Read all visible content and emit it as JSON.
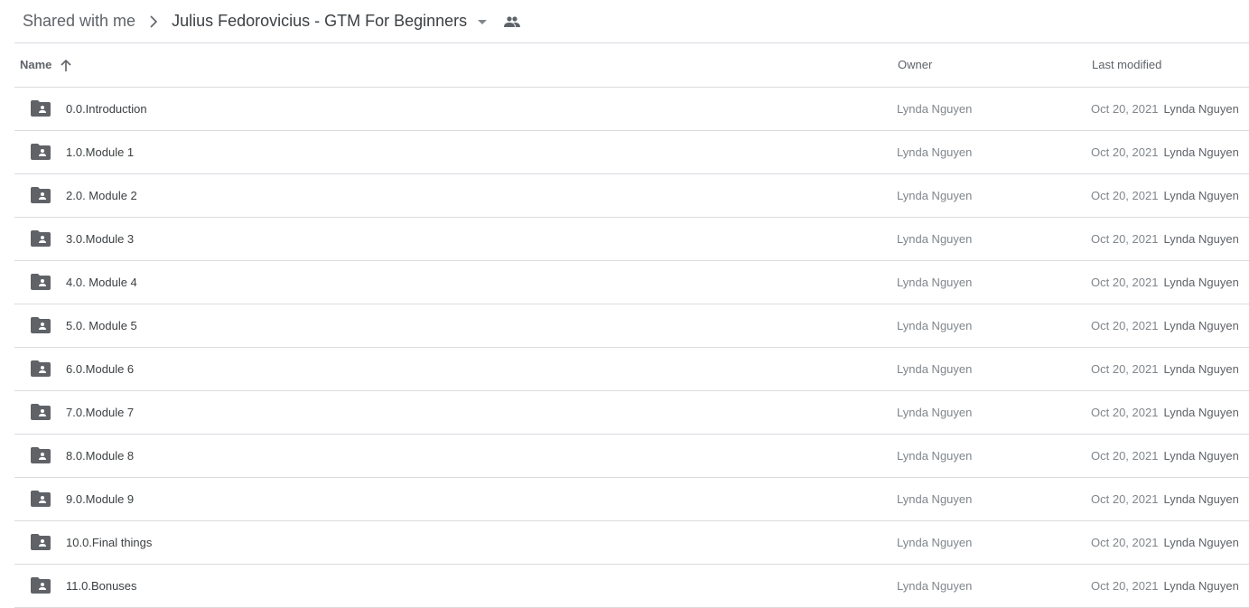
{
  "breadcrumb": {
    "parent": "Shared with me",
    "current": "Julius Fedorovicius - GTM For Beginners",
    "separator_icon": "chevron-right-icon",
    "dropdown_icon": "caret-down-icon",
    "shared_icon": "people-icon"
  },
  "table": {
    "columns": {
      "name": "Name",
      "owner": "Owner",
      "last_modified": "Last modified"
    },
    "sort": {
      "column": "name",
      "direction": "ascending",
      "icon": "arrow-up-icon"
    },
    "rows": [
      {
        "name": "0.0.Introduction",
        "icon": "shared-folder-icon",
        "owner": "Lynda Nguyen",
        "modified_date": "Oct 20, 2021",
        "modified_by": "Lynda Nguyen"
      },
      {
        "name": "1.0.Module 1",
        "icon": "shared-folder-icon",
        "owner": "Lynda Nguyen",
        "modified_date": "Oct 20, 2021",
        "modified_by": "Lynda Nguyen"
      },
      {
        "name": "2.0. Module 2",
        "icon": "shared-folder-icon",
        "owner": "Lynda Nguyen",
        "modified_date": "Oct 20, 2021",
        "modified_by": "Lynda Nguyen"
      },
      {
        "name": "3.0.Module 3",
        "icon": "shared-folder-icon",
        "owner": "Lynda Nguyen",
        "modified_date": "Oct 20, 2021",
        "modified_by": "Lynda Nguyen"
      },
      {
        "name": "4.0. Module 4",
        "icon": "shared-folder-icon",
        "owner": "Lynda Nguyen",
        "modified_date": "Oct 20, 2021",
        "modified_by": "Lynda Nguyen"
      },
      {
        "name": "5.0. Module 5",
        "icon": "shared-folder-icon",
        "owner": "Lynda Nguyen",
        "modified_date": "Oct 20, 2021",
        "modified_by": "Lynda Nguyen"
      },
      {
        "name": "6.0.Module 6",
        "icon": "shared-folder-icon",
        "owner": "Lynda Nguyen",
        "modified_date": "Oct 20, 2021",
        "modified_by": "Lynda Nguyen"
      },
      {
        "name": "7.0.Module 7",
        "icon": "shared-folder-icon",
        "owner": "Lynda Nguyen",
        "modified_date": "Oct 20, 2021",
        "modified_by": "Lynda Nguyen"
      },
      {
        "name": "8.0.Module 8",
        "icon": "shared-folder-icon",
        "owner": "Lynda Nguyen",
        "modified_date": "Oct 20, 2021",
        "modified_by": "Lynda Nguyen"
      },
      {
        "name": "9.0.Module 9",
        "icon": "shared-folder-icon",
        "owner": "Lynda Nguyen",
        "modified_date": "Oct 20, 2021",
        "modified_by": "Lynda Nguyen"
      },
      {
        "name": "10.0.Final things",
        "icon": "shared-folder-icon",
        "owner": "Lynda Nguyen",
        "modified_date": "Oct 20, 2021",
        "modified_by": "Lynda Nguyen"
      },
      {
        "name": "11.0.Bonuses",
        "icon": "shared-folder-icon",
        "owner": "Lynda Nguyen",
        "modified_date": "Oct 20, 2021",
        "modified_by": "Lynda Nguyen"
      }
    ]
  },
  "colors": {
    "folder_icon": "#5f6368",
    "divider": "#dadce0",
    "text_primary": "#3c4043",
    "text_secondary": "#80868b"
  }
}
